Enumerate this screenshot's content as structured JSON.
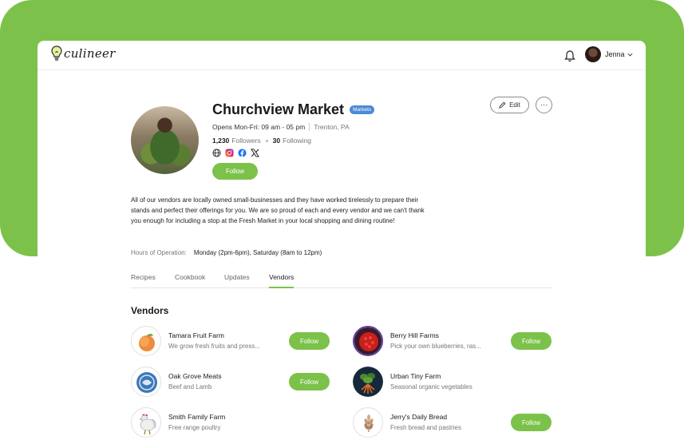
{
  "app": {
    "logo_text": "culineer"
  },
  "header": {
    "user_name": "Jenna"
  },
  "profile": {
    "name": "Churchview Market",
    "badge": "Markets",
    "hours_short": "Opens Mon-Fri: 09 am - 05 pm",
    "location": "Trenton, PA",
    "followers_count": "1,230",
    "followers_label": "Followers",
    "following_count": "30",
    "following_label": "Following",
    "follow_label": "Follow",
    "edit_label": "Edit",
    "more_label": "···",
    "description": "All of our vendors are locally owned small-businesses and they have worked tirelessly to prepare their stands and perfect their offerings for you. We are so proud of each and every vendor and we can't thank you enough for including a stop at the Fresh Market in your local shopping and dining routine!",
    "hours_label": "Hours of Operation:",
    "hours_value": "Monday (2pm-6pm), Saturday (8am to 12pm)",
    "social_icons": [
      "globe-icon",
      "instagram-icon",
      "facebook-icon",
      "x-icon"
    ]
  },
  "tabs": [
    {
      "label": "Recipes",
      "active": false
    },
    {
      "label": "Cookbook",
      "active": false
    },
    {
      "label": "Updates",
      "active": false
    },
    {
      "label": "Vendors",
      "active": true
    }
  ],
  "vendors_title": "Vendors",
  "vendors": [
    {
      "name": "Tamara Fruit Farm",
      "desc": "We grow fresh fruits and press...",
      "follow": "Follow",
      "icon": "peach-icon"
    },
    {
      "name": "Berry Hill Farms",
      "desc": "Pick your own blueberries, ras...",
      "follow": "Follow",
      "icon": "berry-icon"
    },
    {
      "name": "Oak Grove Meats",
      "desc": "Beef and Lamb",
      "follow": "Follow",
      "icon": "meat-logo-icon"
    },
    {
      "name": "Urban Tiny Farm",
      "desc": "Seasonal organic vegetables",
      "follow": "",
      "icon": "vegetables-icon"
    },
    {
      "name": "Smith Family Farm",
      "desc": "Free range poultry",
      "follow": "",
      "icon": "rooster-icon"
    },
    {
      "name": "Jerry's Daily Bread",
      "desc": "Fresh bread and pastries",
      "follow": "Follow",
      "icon": "wheat-icon"
    }
  ],
  "colors": {
    "accent": "#7cc24a",
    "badge": "#4a8ad6",
    "background": "#7cc24a"
  }
}
